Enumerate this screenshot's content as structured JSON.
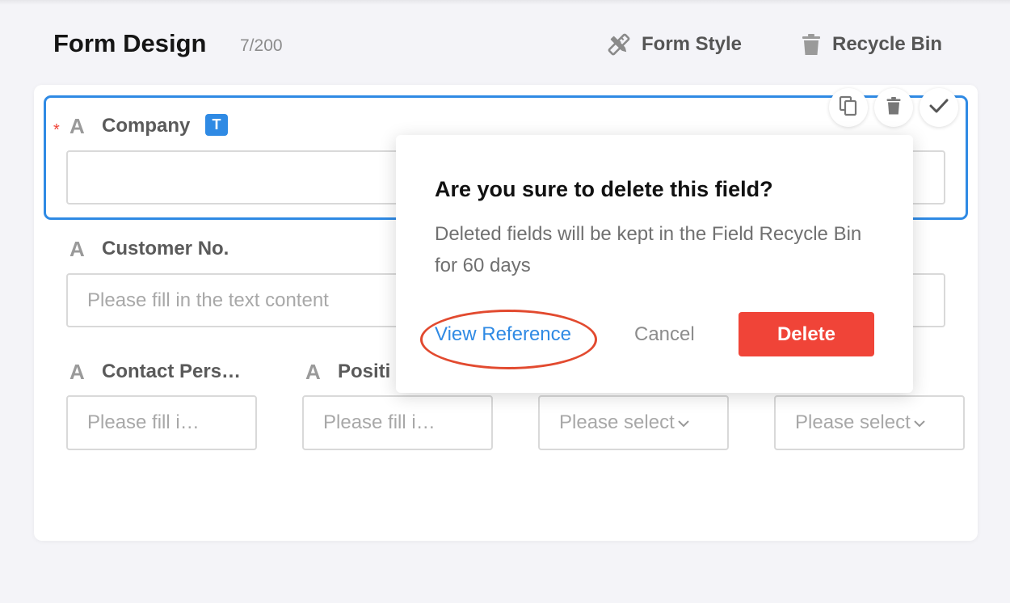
{
  "header": {
    "title": "Form Design",
    "count": "7/200",
    "form_style_label": "Form Style",
    "recycle_bin_label": "Recycle Bin"
  },
  "fields": {
    "company": {
      "icon": "A",
      "label": "Company",
      "type_badge": "T",
      "required_mark": "*",
      "value": ""
    },
    "customer_no": {
      "icon": "A",
      "label": "Customer No.",
      "placeholder": "Please fill in the text content"
    },
    "contact_person": {
      "icon": "A",
      "label": "Contact Pers…",
      "placeholder": "Please fill i…"
    },
    "position": {
      "icon": "A",
      "label": "Positi",
      "placeholder": "Please fill i…"
    },
    "select_1": {
      "placeholder": "Please select"
    },
    "select_2": {
      "placeholder": "Please select"
    }
  },
  "field_toolbar": {
    "icons": [
      "copy-icon",
      "trash-icon",
      "check-icon"
    ]
  },
  "dialog": {
    "title": "Are you sure to delete this field?",
    "message": "Deleted fields will be kept in the Field Recycle Bin for 60 days",
    "view_reference_label": "View Reference",
    "cancel_label": "Cancel",
    "delete_label": "Delete"
  },
  "colors": {
    "accent": "#2f8ae4",
    "danger": "#f04438",
    "annotation": "#e24a2f",
    "background": "#f4f4f8"
  }
}
